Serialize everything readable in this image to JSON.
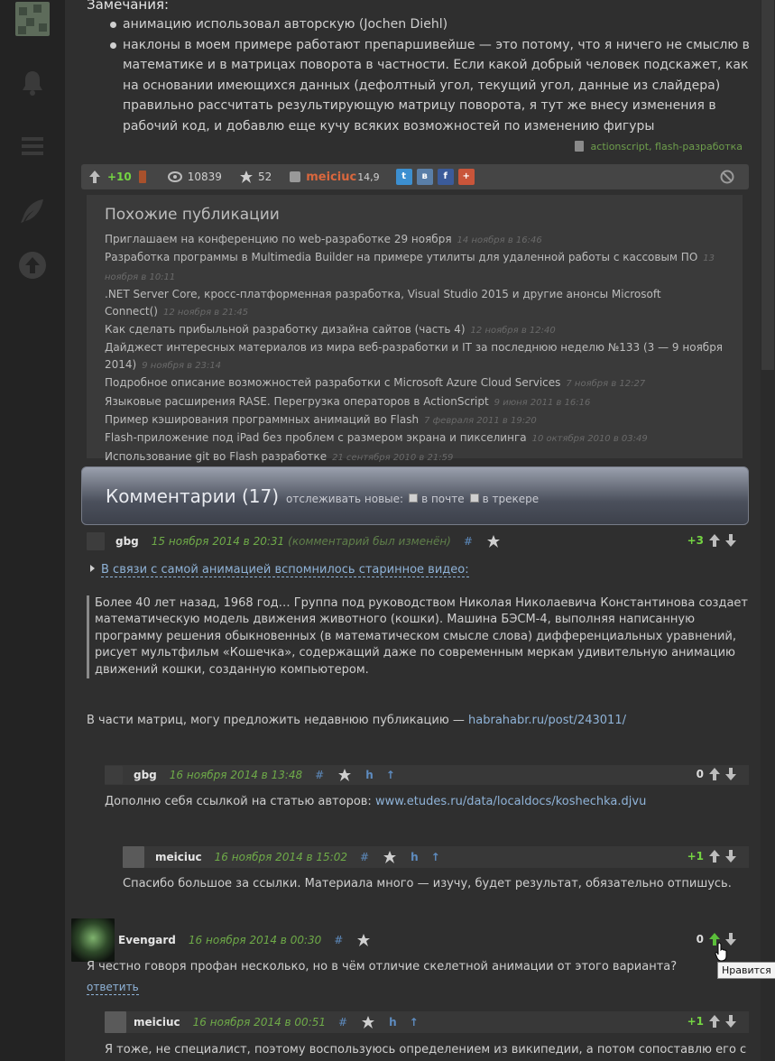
{
  "sidebar": {
    "icons": [
      "logo",
      "bell-icon",
      "menu-icon",
      "feather-icon",
      "scroll-top-icon"
    ]
  },
  "article": {
    "notes_title": "Замечания:",
    "notes": [
      "анимацию использовал авторскую (Jochen Diehl)",
      "наклоны в моем примере работают препаршивейше — это потому, что я ничего не смыслю в математике и в матрицах поворота в частности. Если какой добрый человек подскажет, как на основании имеющихся данных (дефолтный угол, текущий угол, данные из слайдера) правильно рассчитать результирующую матрицу поворота, я тут же внесу изменения в рабочий код, и добавлю еще кучу всяких возможностей по изменению фигуры"
    ],
    "tags": "actionscript, flash-разработка"
  },
  "infobar": {
    "score": "+10",
    "views": "10839",
    "favorites": "52",
    "author": "meiciuc",
    "karma": "14,9",
    "share": [
      {
        "label": "t",
        "color": "#3c8fd0"
      },
      {
        "label": "в",
        "color": "#5a7fa8"
      },
      {
        "label": "f",
        "color": "#3b5b9a"
      },
      {
        "label": "+",
        "color": "#c9553a"
      }
    ]
  },
  "similar": {
    "title": "Похожие публикации",
    "items": [
      {
        "title": "Приглашаем на конференцию по web-разработке 29 ноября",
        "date": "14 ноября в 16:46"
      },
      {
        "title": "Разработка программы в Multimedia Builder на примере утилиты для удаленной работы с кассовым ПО",
        "date": "13 ноября в 10:11"
      },
      {
        "title": ".NET Server Core, кросс-платформенная разработка, Visual Studio 2015 и другие анонсы Microsoft Connect()",
        "date": "12 ноября в 21:45"
      },
      {
        "title": "Как сделать прибыльной разработку дизайна сайтов (часть 4)",
        "date": "12 ноября в 12:40"
      },
      {
        "title": "Дайджест интересных материалов из мира веб-разработки и IT за последнюю неделю №133 (3 — 9 ноября 2014)",
        "date": "9 ноября в 23:14"
      },
      {
        "title": "Подробное описание возможностей разработки с Microsoft Azure Cloud Services",
        "date": "7 ноября в 12:27"
      },
      {
        "title": "Языковые расширения RASE. Перегрузка операторов в ActionScript",
        "date": "9 июня 2011 в 16:16"
      },
      {
        "title": "Пример кэширования программных анимаций во Flash",
        "date": "7 февраля 2011 в 19:20"
      },
      {
        "title": "Flash-приложение под iPad без проблем с размером экрана и пикселинга",
        "date": "10 октября 2010 в 03:49"
      },
      {
        "title": "Использование git во Flash разработке",
        "date": "21 сентября 2010 в 21:59"
      }
    ]
  },
  "comments_header": {
    "title": "Комментарии (17)",
    "follow_label": "отслеживать новые:",
    "by_mail": "в почте",
    "in_tracker": "в трекере"
  },
  "comments": [
    {
      "user": "gbg",
      "date": "15 ноября 2014 в 20:31",
      "edited": "(комментарий был изменён)",
      "hash": "#",
      "score": "+3",
      "spoiler": "В связи с самой анимацией вспомнилось старинное видео:",
      "quote": "Более 40 лет назад, 1968 год… Группа под руководством Николая Николаевича Константинова создает математическую модель движения животного (кошки). Машина БЭСМ-4, выполняя написанную программу решения обыкновенных (в математическом смысле слова) дифференциальных уравнений, рисует мультфильм «Кошечка», содержащий даже по современным меркам удивительную анимацию движений кошки, созданную компьютером.",
      "text_before": "В части матриц, могу предложить недавнюю публикацию — ",
      "link": "habrahabr.ru/post/243011/"
    },
    {
      "user": "gbg",
      "date": "16 ноября 2014 в 13:48",
      "hash": "#",
      "h": "h",
      "up": "↑",
      "score": "0",
      "text_before": "Дополню себя ссылкой на статью авторов: ",
      "link": "www.etudes.ru/data/localdocs/koshechka.djvu"
    },
    {
      "user": "meiciuc",
      "date": "16 ноября 2014 в 15:02",
      "hash": "#",
      "h": "h",
      "up": "↑",
      "score": "+1",
      "text": "Спасибо большое за ссылки. Материала много — изучу, будет результат, обязательно отпишусь."
    },
    {
      "user": "Evengard",
      "date": "16 ноября 2014 в 00:30",
      "hash": "#",
      "score": "0",
      "text": "Я честно говоря профан несколько, но в чём отличие скелетной анимации от этого варианта?",
      "reply": "ответить",
      "tooltip": "Нравится"
    },
    {
      "user": "meiciuc",
      "date": "16 ноября 2014 в 00:51",
      "hash": "#",
      "h": "h",
      "up": "↑",
      "score": "+1",
      "text": "Я тоже, не специалист, поэтому воспользуюсь определением из википедии, а потом сопоставлю его с"
    }
  ]
}
